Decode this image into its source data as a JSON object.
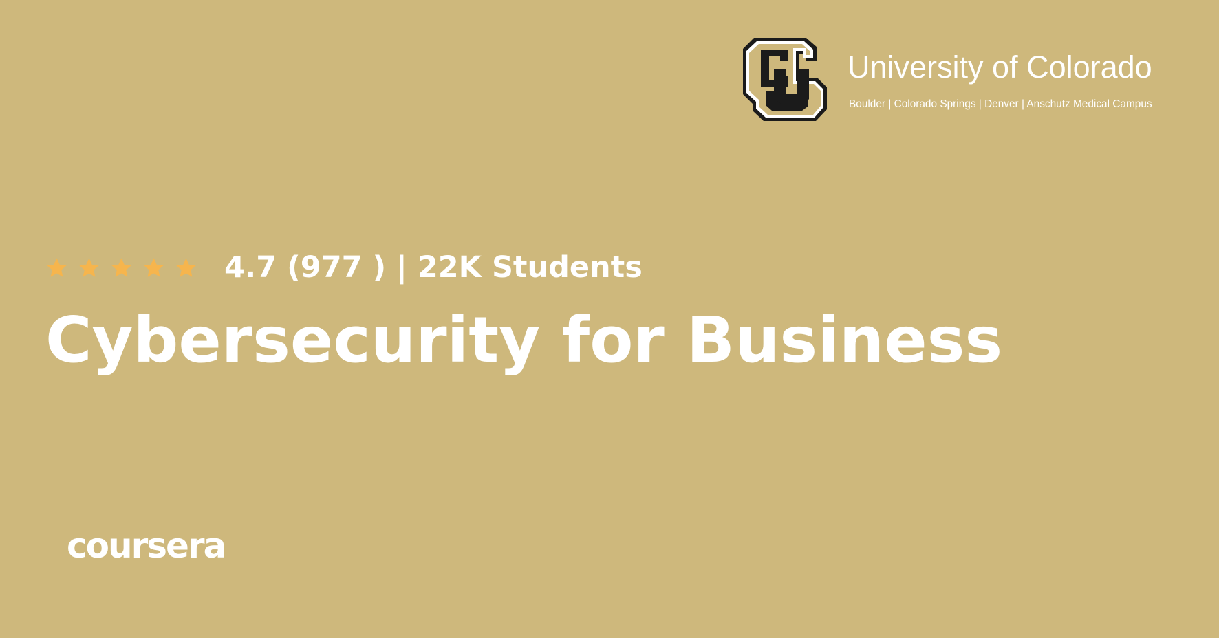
{
  "colors": {
    "background": "#ceb87c",
    "text": "#ffffff",
    "star": "#f6b54d",
    "logo_dark": "#1b1b1b"
  },
  "university_logo": {
    "icon": "cu-logo-icon",
    "name": "University of Colorado",
    "campuses": "Boulder | Colorado Springs | Denver | Anschutz Medical Campus"
  },
  "rating": {
    "stars": 5,
    "star_icon": "star-icon",
    "text": "4.7 (977 ) | 22K Students"
  },
  "course": {
    "title": "Cybersecurity for Business"
  },
  "platform": {
    "logo_text": "coursera"
  }
}
